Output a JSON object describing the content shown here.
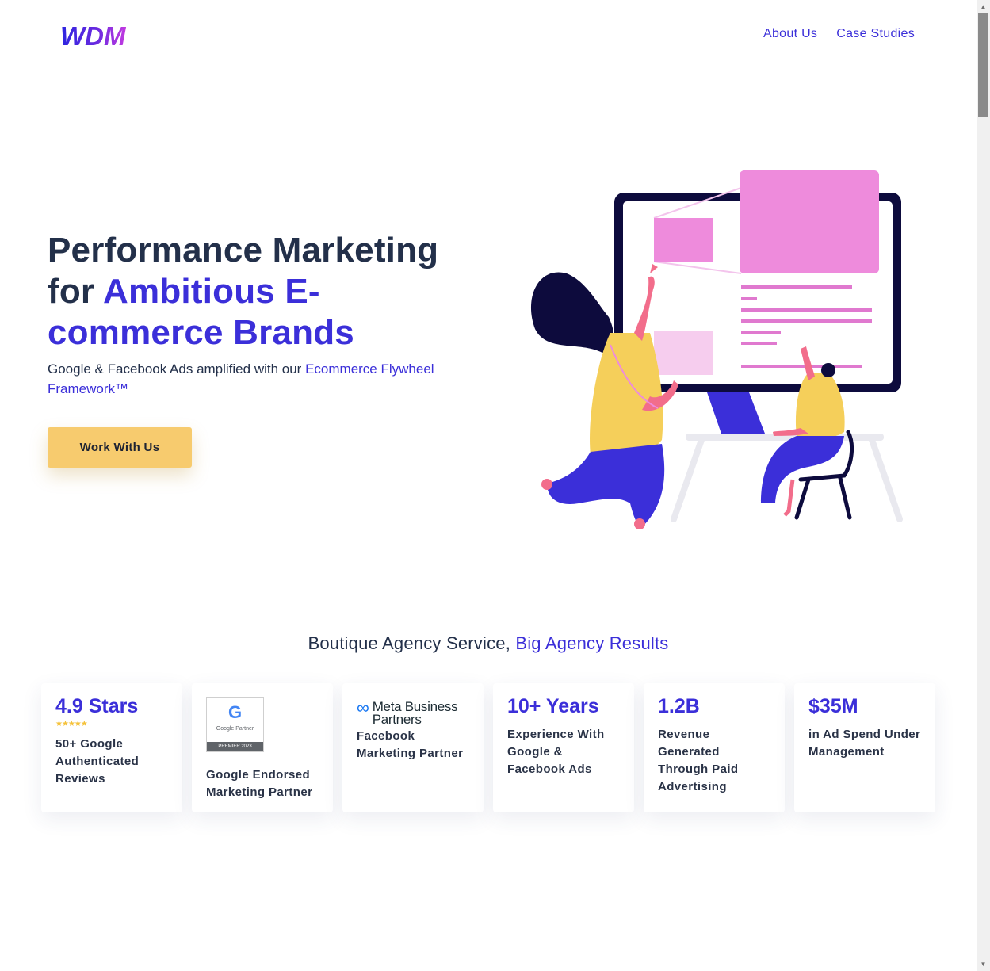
{
  "header": {
    "logo_text": "WDM",
    "nav": [
      "About Us",
      "Case Studies"
    ]
  },
  "hero": {
    "title_part1": "Performance Marketing for ",
    "title_accent": "Ambitious E-commerce Brands",
    "subtitle_part1": "Google & Facebook Ads amplified with our ",
    "subtitle_link": "Ecommerce Flywheel Framework™",
    "cta_label": "Work With Us"
  },
  "stats": {
    "title_part1": "Boutique Agency Service, ",
    "title_accent": "Big Agency Results",
    "cards": [
      {
        "stat": "4.9 Stars",
        "stars": "★★★★★",
        "desc": "50+ Google Authenticated Reviews"
      },
      {
        "badge_letter": "G",
        "badge_text": "Google Partner",
        "badge_footer": "PREMIER 2023",
        "desc": "Google Endorsed Marketing Partner"
      },
      {
        "logo_symbol": "∞",
        "logo_text_line1": "Meta Business",
        "logo_text_line2": "Partners",
        "desc": "Facebook Marketing Partner"
      },
      {
        "stat": "10+ Years",
        "desc": "Experience With Google & Facebook Ads"
      },
      {
        "stat": "1.2B",
        "desc": "Revenue Generated Through Paid Advertising"
      },
      {
        "stat": "$35M",
        "desc": "in Ad Spend Under Management"
      }
    ]
  },
  "colors": {
    "accent": "#3b2fd9",
    "heading": "#23304a",
    "cta": "#f7cb6e",
    "illustration_pink": "#ee8bdc",
    "illustration_yellow": "#f5cf5a"
  }
}
